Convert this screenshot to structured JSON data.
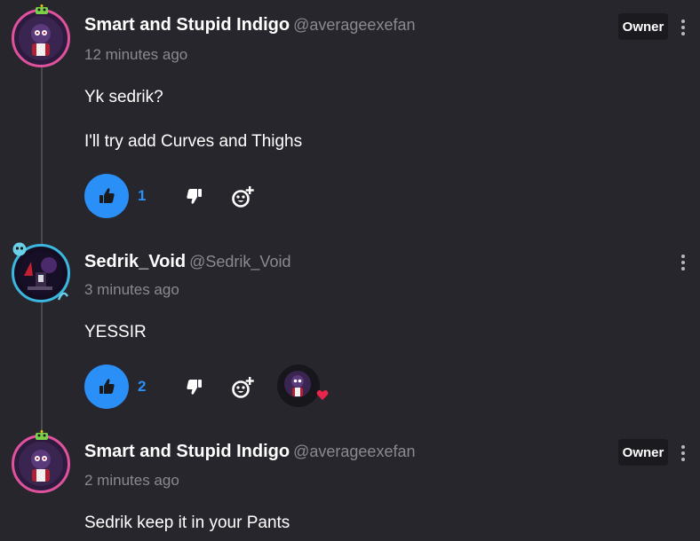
{
  "comments": [
    {
      "author": "Smart and Stupid Indigo",
      "handle": "@averageexefan",
      "time": "12 minutes ago",
      "badge": "Owner",
      "lines": [
        "Yk sedrik?",
        "I'll try add Curves and Thighs"
      ],
      "likes": "1"
    },
    {
      "author": "Sedrik_Void",
      "handle": "@Sedrik_Void",
      "time": "3 minutes ago",
      "lines": [
        "YESSIR"
      ],
      "likes": "2"
    },
    {
      "author": "Smart and Stupid Indigo",
      "handle": "@averageexefan",
      "time": "2 minutes ago",
      "badge": "Owner",
      "lines": [
        "Sedrik keep it in your Pants"
      ]
    }
  ],
  "colors": {
    "background": "#27262c",
    "accent": "#2a8ff7",
    "avatar_ring_owner": "#e0529d",
    "avatar_ring_sedrik": "#3cb8e0",
    "heart": "#e8254a"
  },
  "icons": {
    "like": "thumbs-up-icon",
    "dislike": "thumbs-down-icon",
    "react": "add-reaction-icon",
    "menu": "more-vertical-icon",
    "reaction_heart": "heart-icon"
  }
}
